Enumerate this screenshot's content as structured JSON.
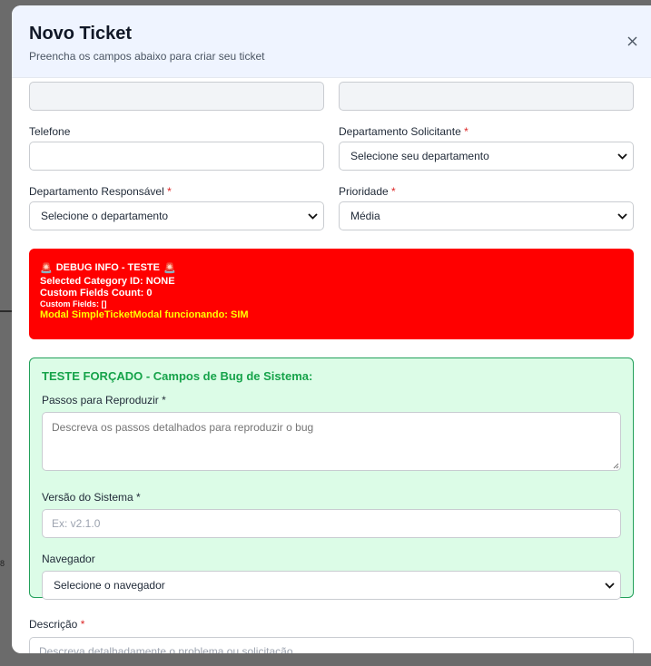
{
  "backdrop": {
    "axis_number": "8"
  },
  "modal": {
    "title": "Novo Ticket",
    "subtitle": "Preencha os campos abaixo para criar seu ticket",
    "close_icon": "close-icon"
  },
  "form": {
    "top_row": {
      "left_value": "",
      "right_value": ""
    },
    "phone": {
      "label": "Telefone",
      "value": ""
    },
    "requesting_department": {
      "label": "Departamento Solicitante",
      "required_mark": "*",
      "selected": "Selecione seu departamento"
    },
    "responsible_department": {
      "label": "Departamento Responsável",
      "required_mark": "*",
      "selected": "Selecione o departamento"
    },
    "priority": {
      "label": "Prioridade",
      "required_mark": "*",
      "selected": "Média"
    },
    "description": {
      "label": "Descrição",
      "required_mark": "*",
      "placeholder": "Descreva detalhadamente o problema ou solicitação..."
    }
  },
  "debug": {
    "icon": "siren-emoji",
    "siren_glyph": "🚨",
    "title": "DEBUG INFO - TESTE",
    "category_line": "Selected Category ID: NONE",
    "count_line": "Custom Fields Count: 0",
    "fields_line": "Custom Fields: []",
    "modal_line": "Modal SimpleTicketModal funcionando: SIM",
    "colors": {
      "background": "#ff0000",
      "highlight": "#ffff00"
    }
  },
  "bug_section": {
    "title": "TESTE FORÇADO - Campos de Bug de Sistema:",
    "steps": {
      "label": "Passos para Reproduzir *",
      "placeholder": "Descreva os passos detalhados para reproduzir o bug"
    },
    "version": {
      "label": "Versão do Sistema *",
      "placeholder": "Ex: v2.1.0"
    },
    "browser": {
      "label": "Navegador",
      "selected": "Selecione o navegador"
    },
    "colors": {
      "background": "#dcfce7",
      "border": "#22a05a",
      "title": "#16a34a"
    }
  }
}
